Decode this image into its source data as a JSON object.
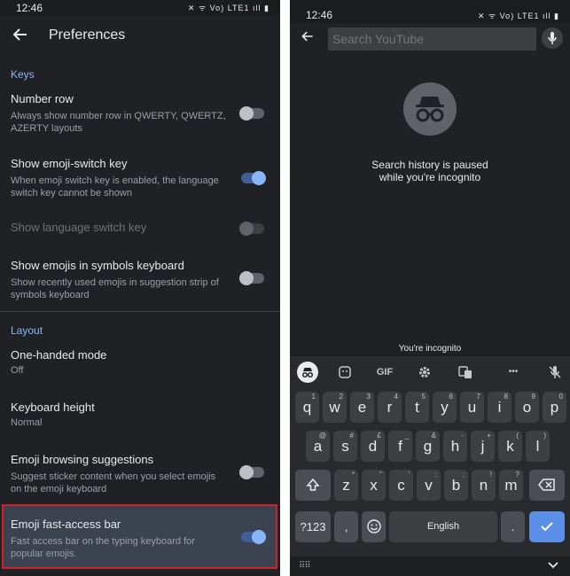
{
  "left": {
    "status_time": "12:46",
    "status_icons": "✕ ᯤ Vo) LTE1 ıll ▮",
    "title": "Preferences",
    "sections": {
      "keys": "Keys",
      "layout": "Layout"
    },
    "items": [
      {
        "title": "Number row",
        "subtitle": "Always show number row in QWERTY, QWERTZ, AZERTY layouts",
        "toggle": "off"
      },
      {
        "title": "Show emoji-switch key",
        "subtitle": "When emoji switch key is enabled, the language switch key cannot be shown",
        "toggle": "on"
      },
      {
        "title": "Show language switch key",
        "subtitle": "",
        "toggle": "disabled"
      },
      {
        "title": "Show emojis in symbols keyboard",
        "subtitle": "Show recently used emojis in suggestion strip of symbols keyboard",
        "toggle": "off"
      },
      {
        "title": "One-handed mode",
        "subtitle": "Off"
      },
      {
        "title": "Keyboard height",
        "subtitle": "Normal"
      },
      {
        "title": "Emoji browsing suggestions",
        "subtitle": "Suggest sticker content when you select emojis on the emoji keyboard",
        "toggle": "off"
      },
      {
        "title": "Emoji fast-access bar",
        "subtitle": "Fast access bar on the typing keyboard for popular emojis.",
        "toggle": "on"
      }
    ]
  },
  "right": {
    "status_time": "12:46",
    "status_icons": "✕ ᯤ Vo) LTE1 ıll ▮",
    "search_placeholder": "Search YouTube",
    "paused_line1": "Search history is paused",
    "paused_line2": "while you're incognito",
    "youre_incognito": "You're incognito",
    "toolbar": {
      "gif": "GIF",
      "more": "•••"
    },
    "rows": [
      [
        [
          "q",
          "1"
        ],
        [
          "w",
          "2"
        ],
        [
          "e",
          "3"
        ],
        [
          "r",
          "4"
        ],
        [
          "t",
          "5"
        ],
        [
          "y",
          "6"
        ],
        [
          "u",
          "7"
        ],
        [
          "i",
          "8"
        ],
        [
          "o",
          "9"
        ],
        [
          "p",
          "0"
        ]
      ],
      [
        [
          "a",
          "@"
        ],
        [
          "s",
          "#"
        ],
        [
          "d",
          "£"
        ],
        [
          "f",
          "_"
        ],
        [
          "g",
          "&"
        ],
        [
          "h",
          "-"
        ],
        [
          "j",
          "+"
        ],
        [
          "k",
          "("
        ],
        [
          "l",
          ")"
        ]
      ],
      [
        [
          "z",
          "*"
        ],
        [
          "x",
          "\""
        ],
        [
          "c",
          "'"
        ],
        [
          "v",
          ":"
        ],
        [
          "b",
          ";"
        ],
        [
          "n",
          "!"
        ],
        [
          "m",
          "?"
        ]
      ]
    ],
    "sym_key": "?123",
    "comma": ",",
    "space": "English",
    "period": "."
  },
  "colors": {
    "accent": "#8ab4f8",
    "highlight_border": "#d0202a",
    "enter": "#5b8ee6"
  }
}
